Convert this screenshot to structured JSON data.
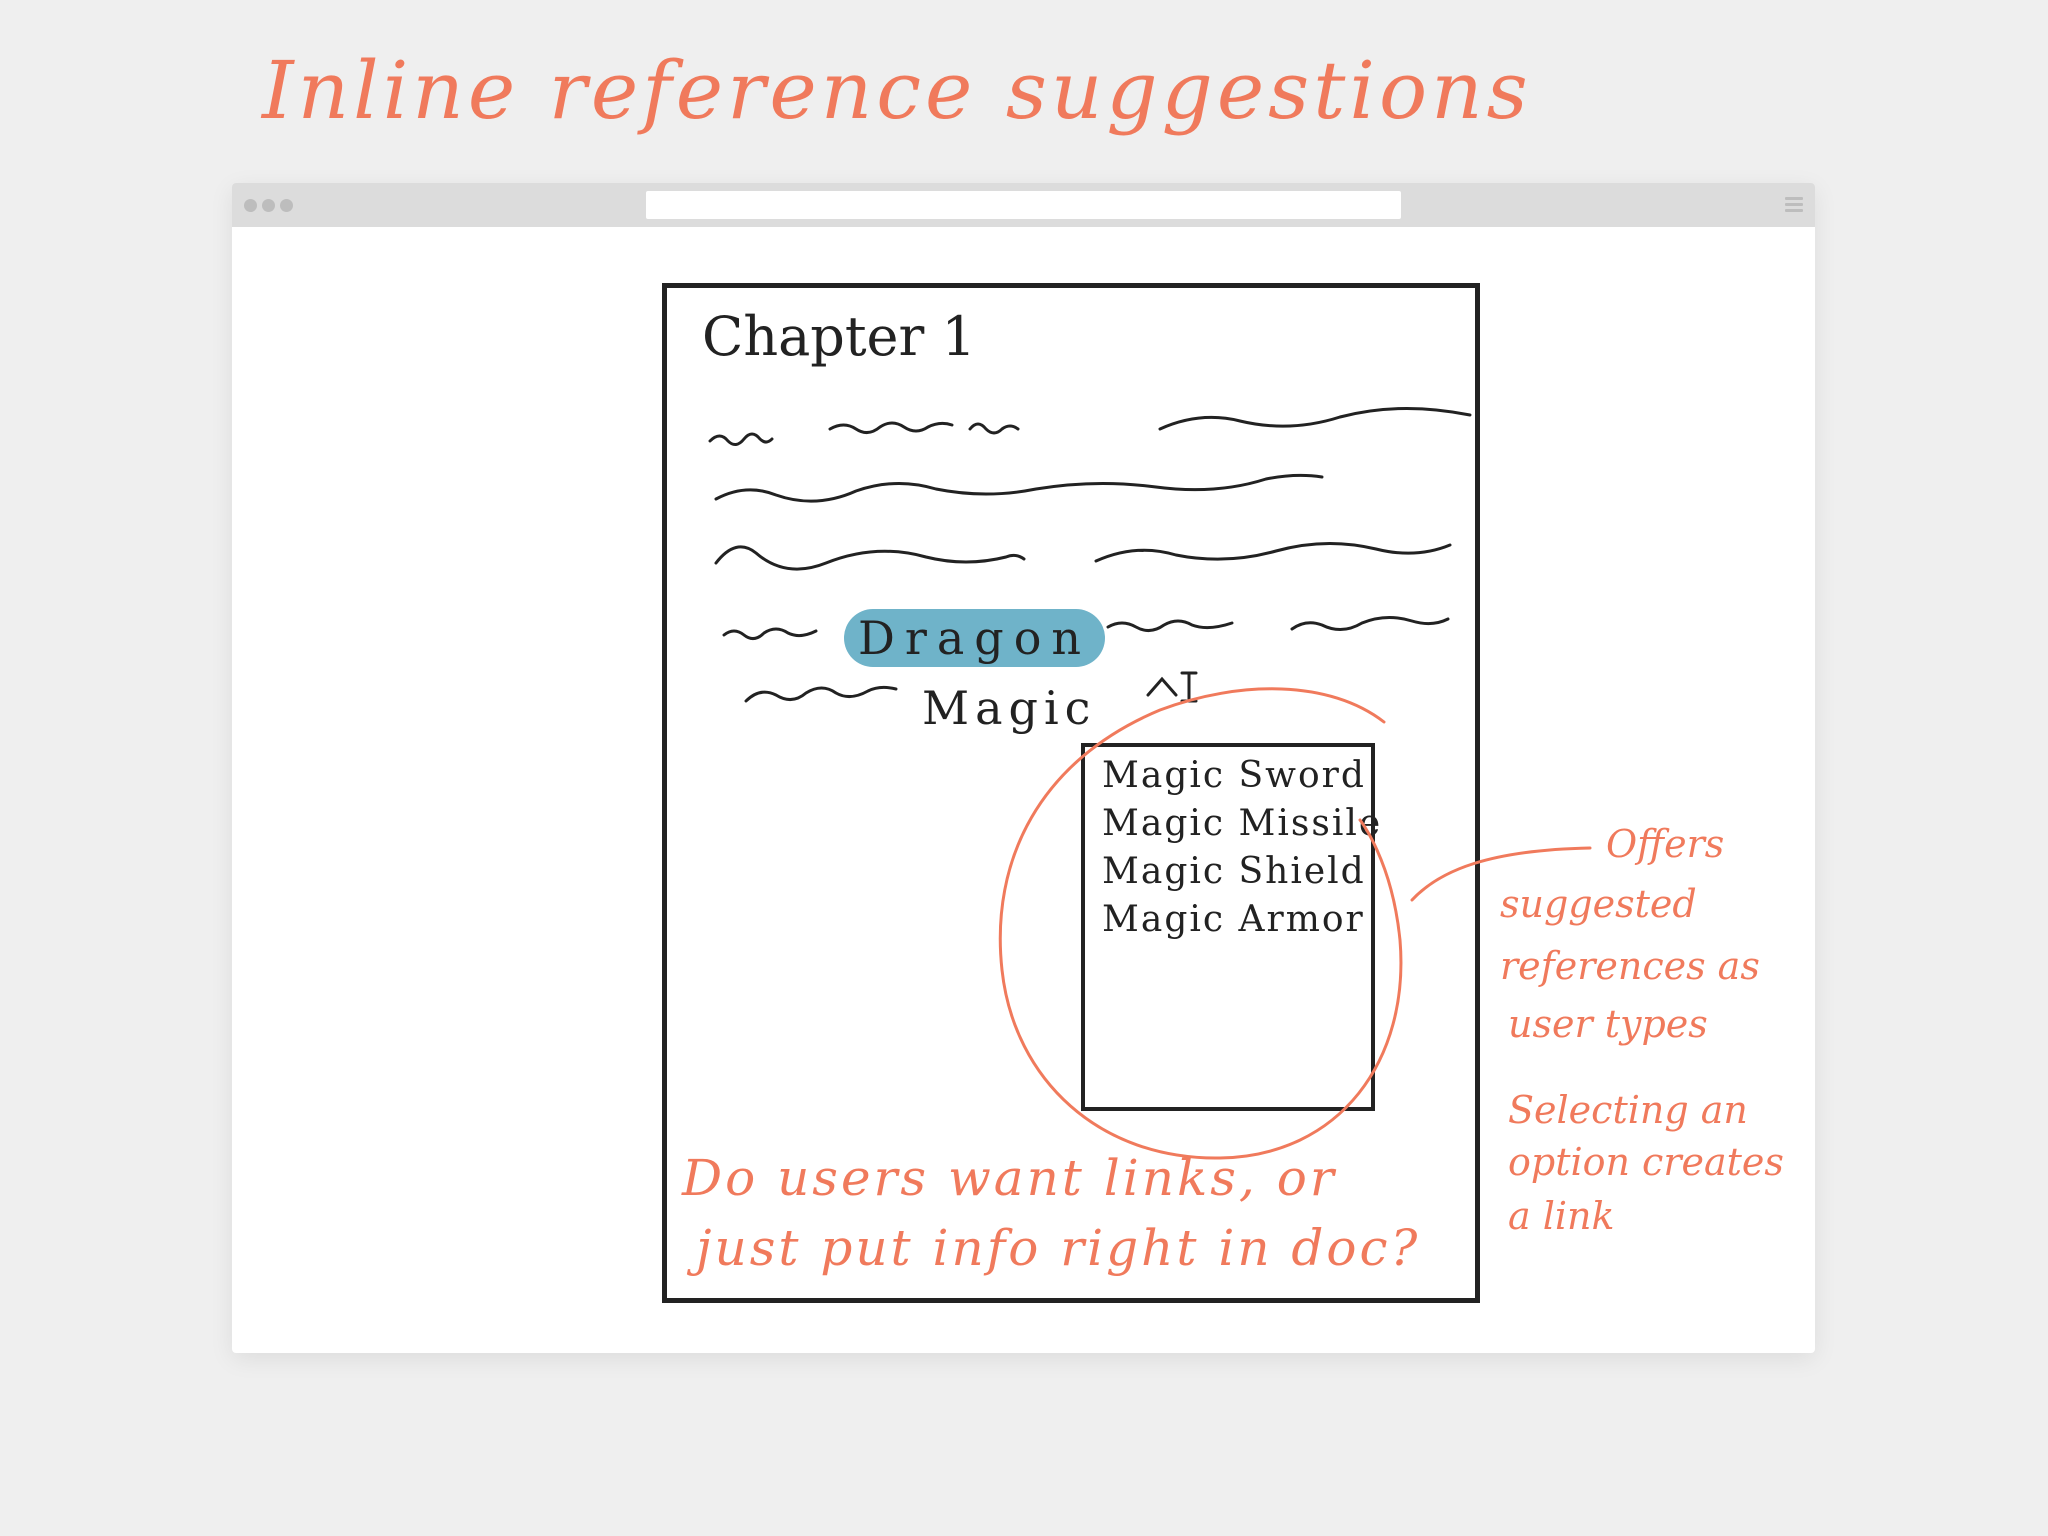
{
  "title": "Inline reference suggestions",
  "document": {
    "heading": "Chapter 1",
    "highlighted_reference": "Dragon",
    "typed_text": "Magic"
  },
  "suggestions": {
    "items": [
      "Magic Sword",
      "Magic Missile",
      "Magic Shield",
      "Magic Armor"
    ]
  },
  "annotations": {
    "right_note_1": [
      "Offers",
      "suggested",
      "references as",
      "user types"
    ],
    "right_note_2": [
      "Selecting an",
      "option creates",
      "a link"
    ],
    "bottom_question": [
      "Do users want links, or",
      "just put info right in doc?"
    ]
  },
  "colors": {
    "annotation": "#f07a5c",
    "highlight": "#6fb3c9",
    "ink": "#222222",
    "background": "#efefef"
  }
}
